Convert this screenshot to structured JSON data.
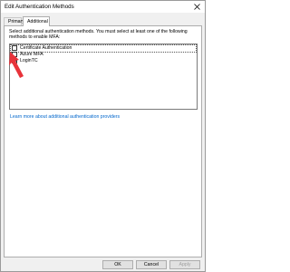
{
  "window": {
    "title": "Edit Authentication Methods"
  },
  "tabs": [
    {
      "label": "Primary",
      "selected": false
    },
    {
      "label": "Additional",
      "selected": true
    }
  ],
  "panel": {
    "description": "Select additional authentication methods. You must select at least one of the following methods to enable MFA:",
    "methods": [
      {
        "label": "Certificate Authentication",
        "checked": false
      },
      {
        "label": "Azure MFA",
        "checked": false
      },
      {
        "label": "LoginTC",
        "checked": true
      }
    ],
    "learn_more_link": "Learn more about additional authentication providers"
  },
  "buttons": {
    "ok": "OK",
    "cancel": "Cancel",
    "apply": "Apply"
  },
  "icons": {
    "close": "close-icon",
    "checkmark": "checkmark-icon",
    "annotation_arrow": "red-arrow-icon"
  },
  "colors": {
    "link": "#0066cc",
    "arrow": "#e8333a"
  }
}
